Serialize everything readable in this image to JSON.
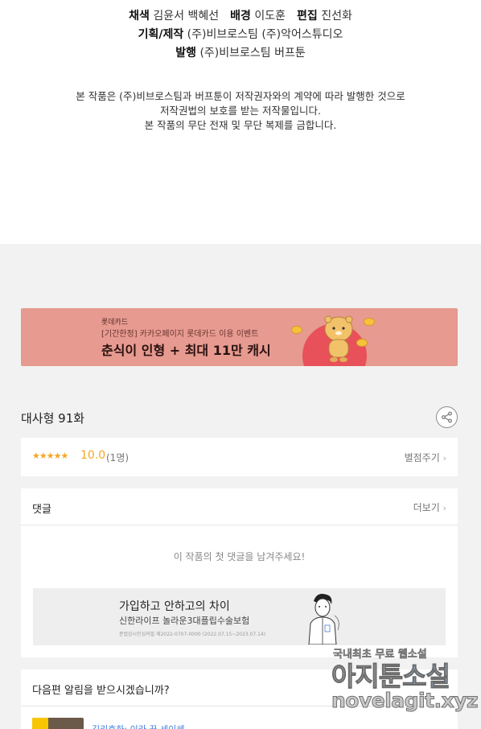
{
  "credits": {
    "top_partial": "",
    "line1": {
      "k1": "채색",
      "v1": "김윤서 백혜선",
      "k2": "배경",
      "v2": "이도훈",
      "k3": "편집",
      "v3": "진선화"
    },
    "line2": {
      "k": "기획/제작",
      "v": "(주)비브로스팀  (주)악어스튜디오"
    },
    "line3": {
      "k": "발행",
      "v": "(주)비브로스팀  버프툰"
    },
    "notice1": "본 작품은 (주)비브로스팀과 버프툰이 저작권자와의 계약에 따라 발행한 것으로",
    "notice2": "저작권법의 보호를 받는 저작물입니다.",
    "notice3": "본 작품의 무단 전재 및 무단 복제를 금합니다."
  },
  "banner": {
    "brand": "롯데카드",
    "subtitle": "[기간한정] 카카오페이지 롯데카드 이용 이벤트",
    "headline": "춘식이 인형 + 최대 11만 캐시",
    "bg_color": "#e69a90"
  },
  "episode": {
    "title": "대사형 91화",
    "share_icon": "share-icon"
  },
  "rating": {
    "stars": "★★★★★",
    "score": "10.0",
    "count": "(1명)",
    "rate_label": "별점주기",
    "chevron": "›"
  },
  "comments": {
    "header": "댓글",
    "more_label": "더보기",
    "chevron": "›",
    "empty_text": "이 작품의 첫 댓글을 남겨주세요!",
    "ad": {
      "title": "가입하고 안하고의 차이",
      "subtitle": "신한라이프 놀라운3대플립수술보험",
      "fine_print": "준법감시인심의필 제2022-0707-0000 (2022.07.15~2023.07.14)"
    }
  },
  "notify": {
    "header": "다음편 알림을 받으시겠습니까?",
    "link_text": "김리호하: 이라 꾼 세이쎄"
  },
  "watermark": {
    "small_gray": "국내최초 무료",
    "small_blue": "웹소설",
    "big_gray": "아지툰",
    "big_blue": "소설",
    "url": "novelagit.xyz"
  }
}
